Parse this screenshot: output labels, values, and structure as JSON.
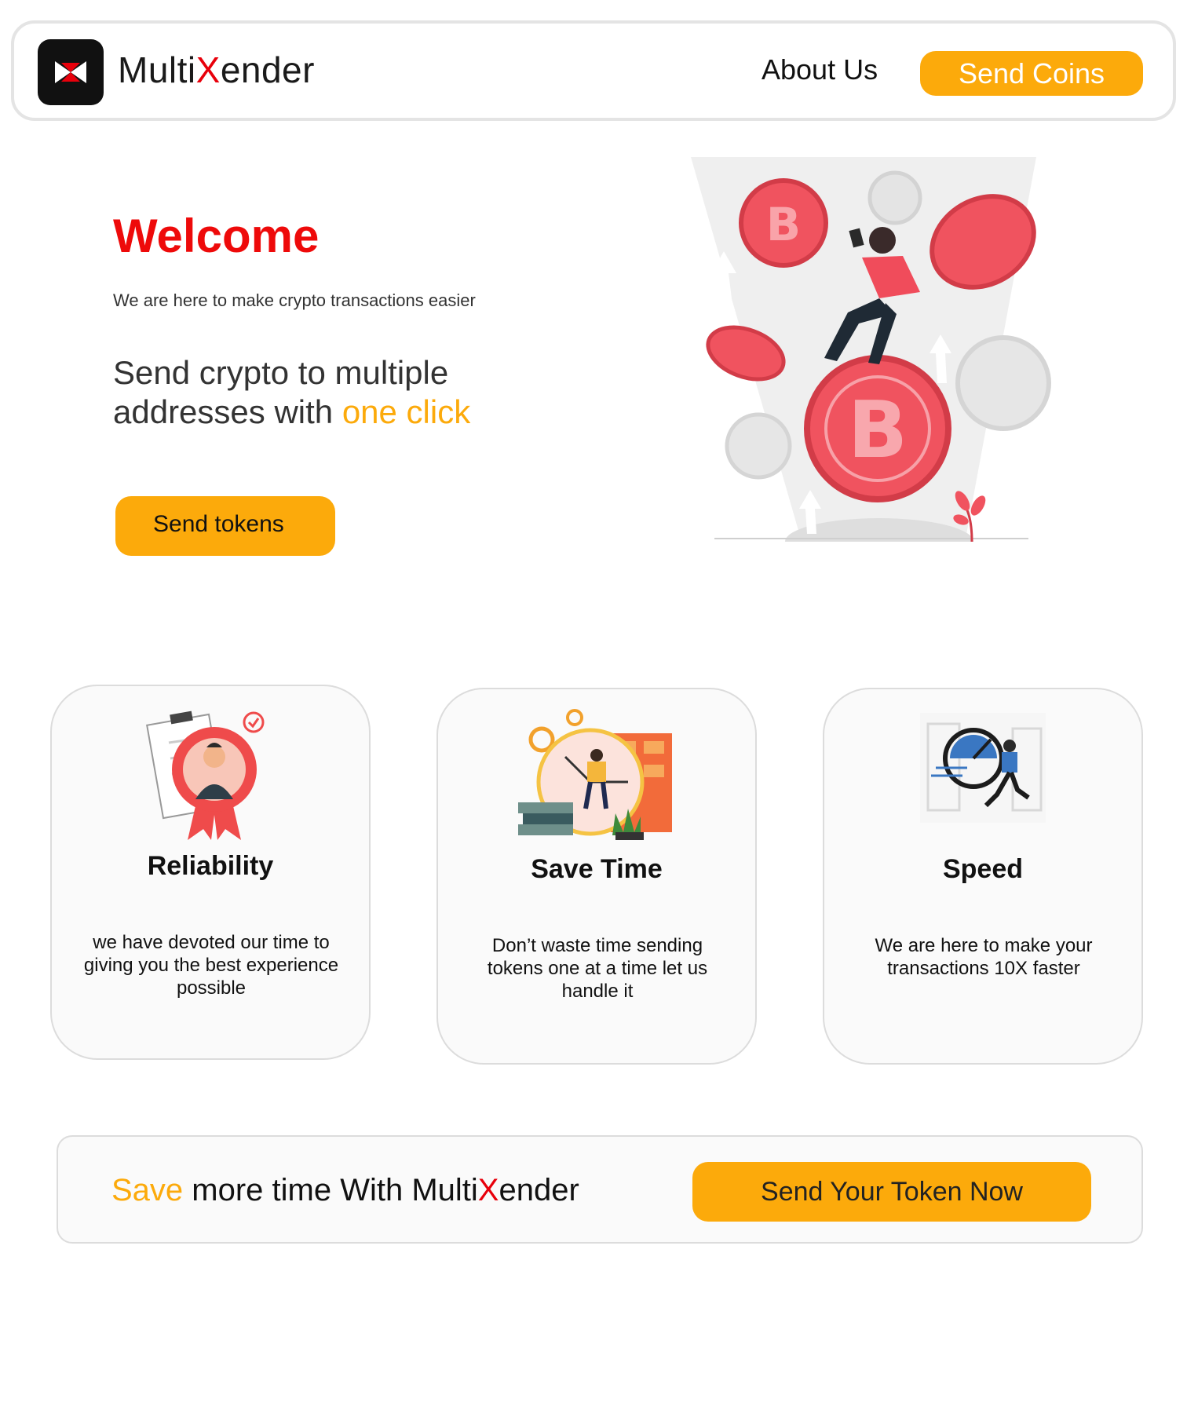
{
  "header": {
    "brand_prefix": "Multi",
    "brand_x": "X",
    "brand_suffix": "ender",
    "nav_about": "About Us",
    "nav_send": "Send Coins"
  },
  "hero": {
    "welcome": "Welcome",
    "tagline": "We are here to make crypto transactions easier",
    "headline_main": "Send crypto to multiple addresses with ",
    "headline_accent": "one click",
    "cta_label": "Send tokens",
    "illustration_icon": "bitcoin-coins-woman-illustration"
  },
  "features": [
    {
      "icon": "reliability-ribbon-illustration",
      "title": "Reliability",
      "desc": "we have devoted our time to giving  you the best experience possible"
    },
    {
      "icon": "save-time-clock-illustration",
      "title": "Save Time",
      "desc": "Don’t waste time sending tokens one at a time let us handle it"
    },
    {
      "icon": "speed-runner-illustration",
      "title": "Speed",
      "desc": "We are here to make your transactions 10X faster"
    }
  ],
  "cta": {
    "accent": "Save",
    "text_main": " more time With Multi",
    "text_x": "X",
    "text_suffix": "ender",
    "button_label": "Send Your Token Now"
  },
  "colors": {
    "accent_orange": "#fcaa0b",
    "brand_red": "#ee0a0a",
    "logo_bg": "#111111"
  }
}
